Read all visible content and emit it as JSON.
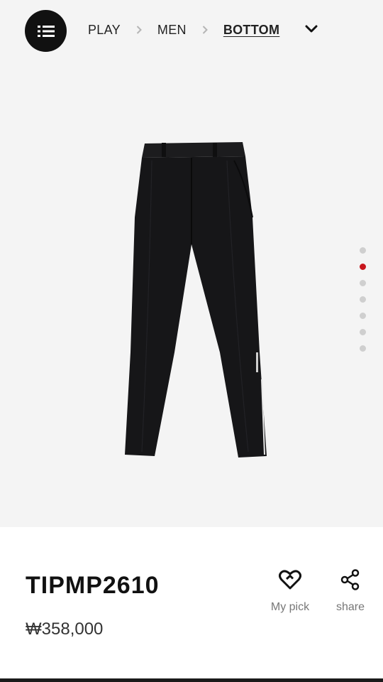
{
  "breadcrumb": {
    "items": [
      "PLAY",
      "MEN",
      "BOTTOM"
    ],
    "active_index": 2
  },
  "icons": {
    "menu": "list-menu-icon",
    "separator": "chevron-right-icon",
    "dropdown": "chevron-down-icon",
    "mypick": "heart-icon",
    "share": "share-icon"
  },
  "gallery": {
    "total_images": 7,
    "active_index": 1
  },
  "product": {
    "name": "TIPMP2610",
    "price": "₩358,000"
  },
  "actions": {
    "mypick_label": "My pick",
    "share_label": "share"
  },
  "colors": {
    "accent": "#c8161d",
    "dark": "#111111",
    "hero_bg": "#f4f4f4"
  }
}
